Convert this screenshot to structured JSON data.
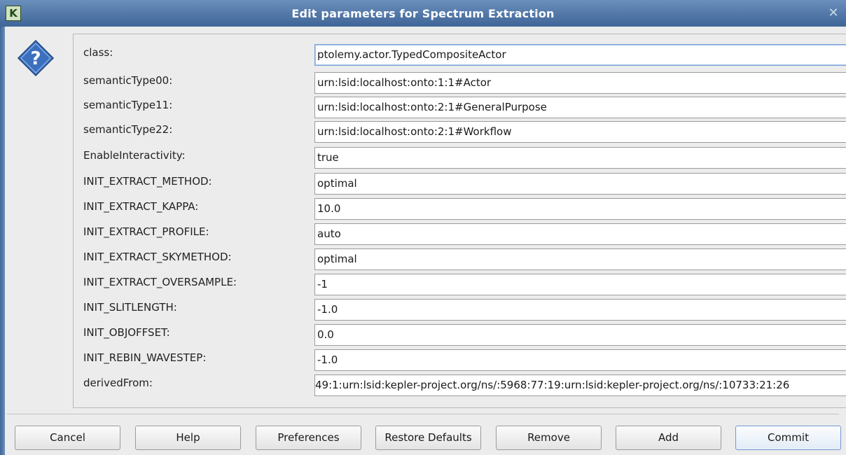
{
  "window": {
    "title": "Edit parameters for Spectrum Extraction",
    "app_icon_letter": "K",
    "close_glyph": "✕"
  },
  "params": [
    {
      "label": "class:",
      "value": "ptolemy.actor.TypedCompositeActor"
    },
    {
      "label": "semanticType00:",
      "value": "urn:lsid:localhost:onto:1:1#Actor"
    },
    {
      "label": "semanticType11:",
      "value": "urn:lsid:localhost:onto:2:1#GeneralPurpose"
    },
    {
      "label": "semanticType22:",
      "value": "urn:lsid:localhost:onto:2:1#Workflow"
    },
    {
      "label": "EnableInteractivity:",
      "value": "true"
    },
    {
      "label": "INIT_EXTRACT_METHOD:",
      "value": "optimal"
    },
    {
      "label": "INIT_EXTRACT_KAPPA:",
      "value": "10.0"
    },
    {
      "label": "INIT_EXTRACT_PROFILE:",
      "value": "auto"
    },
    {
      "label": "INIT_EXTRACT_SKYMETHOD:",
      "value": "optimal"
    },
    {
      "label": "INIT_EXTRACT_OVERSAMPLE:",
      "value": "-1"
    },
    {
      "label": "INIT_SLITLENGTH:",
      "value": "-1.0"
    },
    {
      "label": "INIT_OBJOFFSET:",
      "value": "0.0"
    },
    {
      "label": "INIT_REBIN_WAVESTEP:",
      "value": "-1.0"
    },
    {
      "label": "derivedFrom:",
      "value": "49:1:urn:lsid:kepler-project.org/ns/:5968:77:19:urn:lsid:kepler-project.org/ns/:10733:21:26"
    }
  ],
  "buttons": {
    "cancel": "Cancel",
    "help": "Help",
    "preferences": "Preferences",
    "restore_defaults": "Restore Defaults",
    "remove": "Remove",
    "add": "Add",
    "commit": "Commit"
  },
  "colors": {
    "titlebar": "#3f6597",
    "help_icon": "#4a7bc4"
  },
  "icons": {
    "app": "kepler-app-icon",
    "dialog": "question-diamond-icon",
    "close": "close-icon"
  }
}
